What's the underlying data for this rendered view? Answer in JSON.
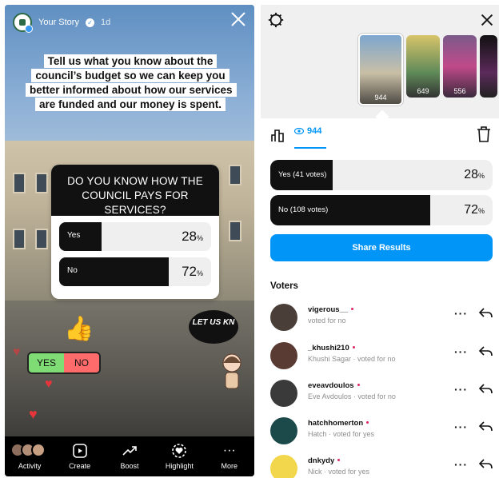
{
  "story": {
    "username": "Your Story",
    "time": "1d",
    "caption": "Tell us what you know about the council’s budget so we can keep you better informed about how our services are funded and our money is spent.",
    "poll": {
      "question": "DO YOU KNOW HOW THE COUNCIL PAYS FOR SERVICES?",
      "options": [
        {
          "label": "Yes",
          "percent": "28",
          "fraction": 0.28
        },
        {
          "label": "No",
          "percent": "72",
          "fraction": 0.72
        }
      ],
      "percent_sign": "%"
    },
    "sticker_letusknow": "LET US KN",
    "sticker_yes": "YES",
    "sticker_no": "NO",
    "bottom_bar": [
      {
        "label": "Activity",
        "icon": "viewers-avatars"
      },
      {
        "label": "Create",
        "icon": "reels-icon"
      },
      {
        "label": "Boost",
        "icon": "trend-icon"
      },
      {
        "label": "Highlight",
        "icon": "heart-circle-icon"
      },
      {
        "label": "More",
        "icon": "more-icon"
      }
    ]
  },
  "insights": {
    "thumbnails": [
      {
        "count": "944",
        "selected": true
      },
      {
        "count": "649"
      },
      {
        "count": "556"
      },
      {
        "count": ""
      }
    ],
    "views_tab": "944",
    "results": [
      {
        "label": "Yes (41 votes)",
        "percent": "28",
        "fraction": 0.28
      },
      {
        "label": "No (108 votes)",
        "percent": "72",
        "fraction": 0.72
      }
    ],
    "percent_sign": "%",
    "share_button": "Share Results",
    "voters_title": "Voters",
    "voters": [
      {
        "username": "vigerous__",
        "subtitle": "voted for no",
        "avatar_color": "#4a3e38"
      },
      {
        "username": "_khushi210",
        "subtitle": "Khushi Sagar · voted for no",
        "avatar_color": "#5a3b34"
      },
      {
        "username": "eveavdoulos",
        "subtitle": "Eve Avdoulos · voted for no",
        "avatar_color": "#3a3a3a"
      },
      {
        "username": "hatchhomerton",
        "subtitle": "Hatch · voted for yes",
        "avatar_color": "#1c4a4a"
      },
      {
        "username": "dnkydy",
        "subtitle": "Nick · voted for yes",
        "avatar_color": "#f2d64b"
      }
    ],
    "colors": {
      "accent": "#0095f6",
      "bar_fill": "#111111",
      "bar_track": "#efefef",
      "dot": "#e0245e"
    }
  }
}
